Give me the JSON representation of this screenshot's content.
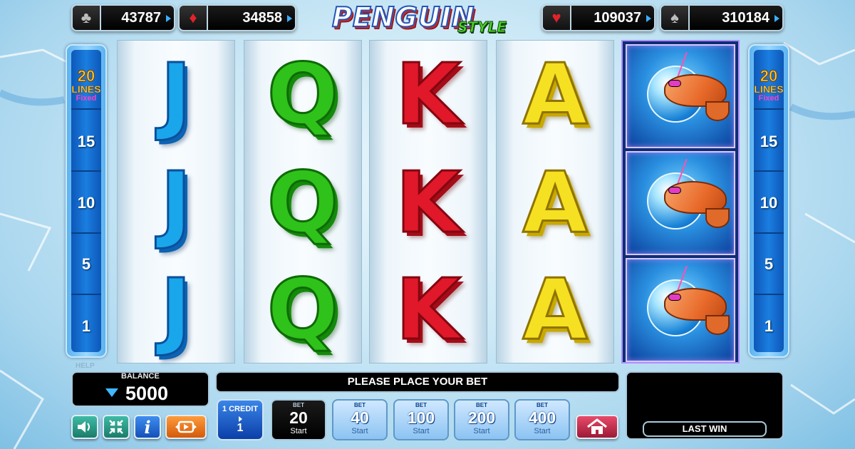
{
  "jackpots": [
    {
      "suit": "clubs",
      "glyph": "♣",
      "value": "43787",
      "color": "#bbbbbb"
    },
    {
      "suit": "diamonds",
      "glyph": "♦",
      "value": "34858",
      "color": "#e0232b"
    },
    {
      "suit": "hearts",
      "glyph": "♥",
      "value": "109037",
      "color": "#e0232b"
    },
    {
      "suit": "spades",
      "glyph": "♠",
      "value": "310184",
      "color": "#bbbbbb"
    }
  ],
  "logo": {
    "main": "PENGUIN",
    "sub": "STYLE"
  },
  "lines_panel": {
    "count": "20",
    "lines_label": "LINES",
    "fixed_label": "Fixed",
    "markers": [
      "15",
      "10",
      "5",
      "1"
    ]
  },
  "help_label": "HELP",
  "reels": [
    {
      "symbols": [
        "J",
        "J",
        "J"
      ],
      "icon": "ice-letter"
    },
    {
      "symbols": [
        "Q",
        "Q",
        "Q"
      ],
      "icon": "emerald-letter"
    },
    {
      "symbols": [
        "K",
        "K",
        "K"
      ],
      "icon": "ruby-letter"
    },
    {
      "symbols": [
        "A",
        "A",
        "A"
      ],
      "icon": "gold-letter"
    },
    {
      "symbols": [
        "shrimp",
        "shrimp",
        "shrimp"
      ],
      "icon": "shrimp-in-bubble-icon"
    }
  ],
  "balance": {
    "label": "BALANCE",
    "amount": "5000",
    "icon": "diamond-icon"
  },
  "message": "PLEASE PLACE YOUR BET",
  "last_win": {
    "label": "LAST WIN",
    "amount": ""
  },
  "controls": {
    "sound_icon": "speaker-icon",
    "fullscreen_icon": "collapse-arrows-icon",
    "info_label": "i",
    "autoplay_icon": "autoplay-icon",
    "home_icon": "home-icon"
  },
  "credit": {
    "label": "1 CREDIT",
    "value": "1"
  },
  "bets": [
    {
      "label": "BET",
      "value": "20",
      "action": "Start",
      "active": true
    },
    {
      "label": "BET",
      "value": "40",
      "action": "Start",
      "active": false
    },
    {
      "label": "BET",
      "value": "100",
      "action": "Start",
      "active": false
    },
    {
      "label": "BET",
      "value": "200",
      "action": "Start",
      "active": false
    },
    {
      "label": "BET",
      "value": "400",
      "action": "Start",
      "active": false
    }
  ],
  "colors": {
    "accent": "#1a7ee0",
    "jackpot_arrow": "#3ab0ff",
    "lines_gold": "#ffd23a",
    "fixed_pink": "#ff3ec8"
  }
}
